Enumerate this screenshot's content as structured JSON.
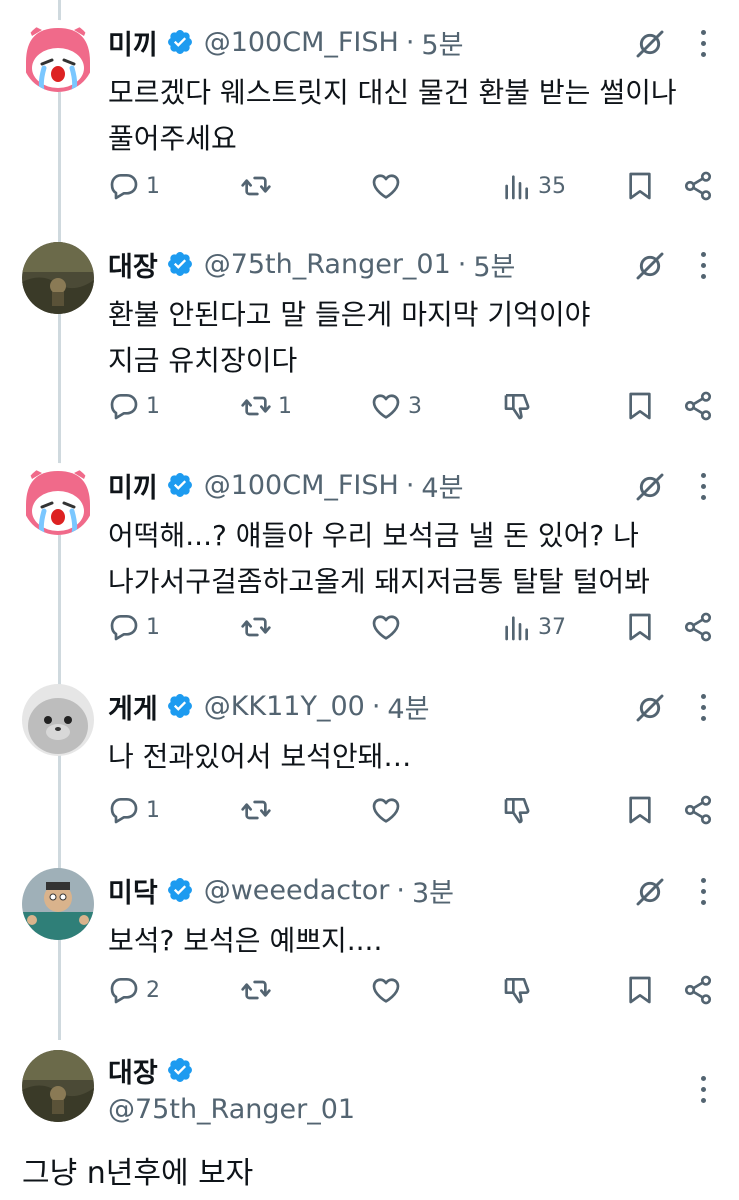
{
  "colors": {
    "verified": "#1d9bf0",
    "muted": "#536471",
    "text": "#0f1419",
    "thread_line": "#cfd9de"
  },
  "tweets": [
    {
      "name": "미끼",
      "handle": "@100CM_FISH",
      "sep": "·",
      "time": "5분",
      "text": "모르겠다 웨스트릿지 대신 물건 환불 받는 썰이나\n풀어주세요",
      "reply": "1",
      "retweet": "",
      "like": "",
      "views": "35",
      "fourth": "views-icon"
    },
    {
      "name": "대장",
      "handle": "@75th_Ranger_01",
      "sep": "·",
      "time": "5분",
      "text": "환불 안된다고 말 들은게 마지막 기억이야\n지금 유치장이다",
      "reply": "1",
      "retweet": "1",
      "like": "3",
      "views": "",
      "fourth": "thumbs-down-icon"
    },
    {
      "name": "미끼",
      "handle": "@100CM_FISH",
      "sep": "·",
      "time": "4분",
      "text": "어떡해...? 얘들아 우리 보석금 낼 돈 있어? 나\n나가서구걸좀하고올게 돼지저금통 탈탈 털어봐",
      "reply": "1",
      "retweet": "",
      "like": "",
      "views": "37",
      "fourth": "views-icon"
    },
    {
      "name": "게게",
      "handle": "@KK11Y_00",
      "sep": "·",
      "time": "4분",
      "text": "나 전과있어서 보석안돼…",
      "reply": "1",
      "retweet": "",
      "like": "",
      "views": "",
      "fourth": "thumbs-down-icon"
    },
    {
      "name": "미닥",
      "handle": "@weeedactor",
      "sep": "·",
      "time": "3분",
      "text": "보석? 보석은 예쁘지....",
      "reply": "2",
      "retweet": "",
      "like": "",
      "views": "",
      "fourth": "thumbs-down-icon"
    }
  ],
  "main_tweet": {
    "name": "대장",
    "handle": "@75th_Ranger_01",
    "text": "그냥 n년후에 보자"
  }
}
